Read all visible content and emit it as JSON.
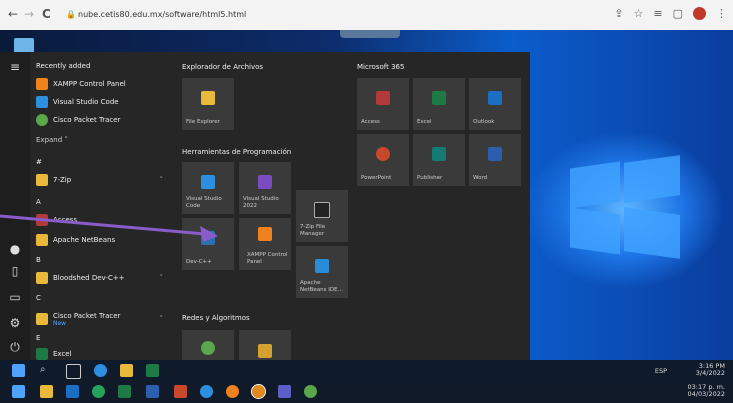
{
  "browser": {
    "url": "nube.cetis80.edu.mx/software/html5.html",
    "back": "←",
    "forward": "→",
    "reload": "C"
  },
  "start_menu": {
    "recent_title": "Recently added",
    "recent": [
      "XAMPP Control Panel",
      "Visual Studio Code",
      "Cisco Packet Tracer"
    ],
    "expand_label": "Expand ˅",
    "sections": [
      {
        "letter": "#",
        "items": [
          {
            "label": "7-Zip",
            "has_chevron": true
          }
        ]
      },
      {
        "letter": "A",
        "items": [
          {
            "label": "Access"
          },
          {
            "label": "Apache NetBeans"
          }
        ]
      },
      {
        "letter": "B",
        "items": [
          {
            "label": "Bloodshed Dev-C++",
            "has_chevron": true
          }
        ]
      },
      {
        "letter": "C",
        "items": [
          {
            "label": "Cisco Packet Tracer",
            "sub": "New",
            "has_chevron": true
          }
        ]
      },
      {
        "letter": "E",
        "items": [
          {
            "label": "Excel"
          }
        ]
      }
    ],
    "groups": {
      "explorer": {
        "title": "Explorador de Archivos",
        "tiles": [
          "File Explorer"
        ]
      },
      "programming": {
        "title": "Herramientas de Programación",
        "tiles": [
          "Visual Studio Code",
          "Visual Studio 2022",
          "7-Zip File Manager",
          "Dev-C++",
          "XAMPP Control Panel",
          "Apache NetBeans IDE..."
        ]
      },
      "networks": {
        "title": "Redes y Algoritmos"
      },
      "ms365": {
        "title": "Microsoft 365",
        "tiles": [
          "Access",
          "Excel",
          "Outlook",
          "PowerPoint",
          "Publisher",
          "Word"
        ]
      }
    }
  },
  "taskbar_inner": {
    "time": "3:16 PM",
    "date": "3/4/2022",
    "lang": "ESP"
  },
  "taskbar_outer": {
    "time": "03:17 p. m.",
    "date": "04/03/2022"
  },
  "colors": {
    "xampp": "#f0821e",
    "vscode": "#2d8fe0",
    "cisco": "#5aa64b",
    "folder": "#e8b93a",
    "access": "#b23a3a",
    "excel": "#1e7a45",
    "outlook": "#1a6fc2",
    "powerpoint": "#c9472b",
    "publisher": "#157a73",
    "word": "#2b5fae",
    "vs2022": "#7a4bc2",
    "arrow": "#8a5cc9"
  }
}
